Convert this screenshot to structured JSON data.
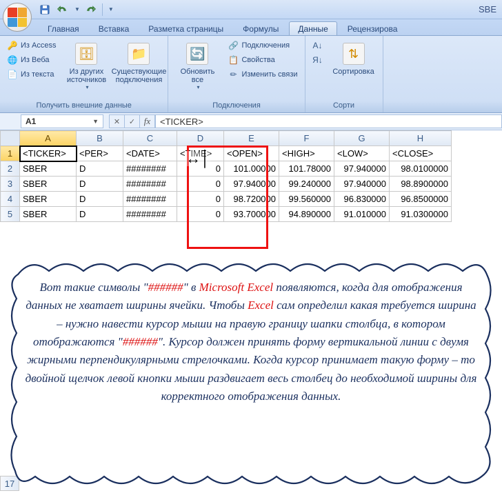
{
  "window": {
    "title": "SBE"
  },
  "qat": {
    "save_icon": "save-icon",
    "undo_icon": "undo-icon",
    "redo_icon": "redo-icon"
  },
  "tabs": [
    {
      "label": "Главная",
      "active": false
    },
    {
      "label": "Вставка",
      "active": false
    },
    {
      "label": "Разметка страницы",
      "active": false
    },
    {
      "label": "Формулы",
      "active": false
    },
    {
      "label": "Данные",
      "active": true
    },
    {
      "label": "Рецензирова",
      "active": false
    }
  ],
  "ribbon": {
    "group1": {
      "label": "Получить внешние данные",
      "access": "Из Access",
      "web": "Из Веба",
      "text": "Из текста",
      "other": "Из других источников",
      "existing": "Существующие подключения"
    },
    "group2": {
      "label": "Подключения",
      "refresh": "Обновить все",
      "connections": "Подключения",
      "properties": "Свойства",
      "editlinks": "Изменить связи"
    },
    "group3": {
      "label": "Сорти",
      "sortaz": "А→Я",
      "sortza": "Я→А",
      "sort": "Сортировка"
    }
  },
  "namebox": {
    "ref": "A1"
  },
  "formula": {
    "fx": "fx",
    "value": "<TICKER>"
  },
  "columns": [
    "A",
    "B",
    "C",
    "D",
    "E",
    "F",
    "G",
    "H"
  ],
  "selected": {
    "col": "A",
    "row": 1
  },
  "rows": [
    {
      "n": 1,
      "A": "<TICKER>",
      "B": "<PER>",
      "C": "<DATE>",
      "D": "<TIME>",
      "E": "<OPEN>",
      "F": "<HIGH>",
      "G": "<LOW>",
      "H": "<CLOSE>"
    },
    {
      "n": 2,
      "A": "SBER",
      "B": "D",
      "C": "########",
      "D": "0",
      "E": "101.00000",
      "F": "101.78000",
      "G": "97.940000",
      "H": "98.0100000"
    },
    {
      "n": 3,
      "A": "SBER",
      "B": "D",
      "C": "########",
      "D": "0",
      "E": "97.940000",
      "F": "99.240000",
      "G": "97.940000",
      "H": "98.8900000"
    },
    {
      "n": 4,
      "A": "SBER",
      "B": "D",
      "C": "########",
      "D": "0",
      "E": "98.720000",
      "F": "99.560000",
      "G": "96.830000",
      "H": "96.8500000"
    },
    {
      "n": 5,
      "A": "SBER",
      "B": "D",
      "C": "########",
      "D": "0",
      "E": "93.700000",
      "F": "94.890000",
      "G": "91.010000",
      "H": "91.0300000"
    }
  ],
  "tail_rows": [
    "17"
  ],
  "callout": {
    "t1": "Вот такие символы \"",
    "hash1": "######",
    "t2": "\" в ",
    "app1": "Microsoft Excel",
    "t3": " появляются, когда для отображения данных не хватает ширины ячейки. Чтобы ",
    "app2": "Excel",
    "t4": " сам определил какая требуется ширина – нужно навести курсор мыши на правую границу шапки столбца, в котором отображаются \"",
    "hash2": "######",
    "t5": "\". Курсор должен принять форму вертикальной линии с двумя жирными перпендикулярными стрелочками. Когда курсор принимает такую форму – то двойной щелчок левой кнопки мыши раздвигает весь столбец до необходимой ширины для корректного отображения данных."
  }
}
